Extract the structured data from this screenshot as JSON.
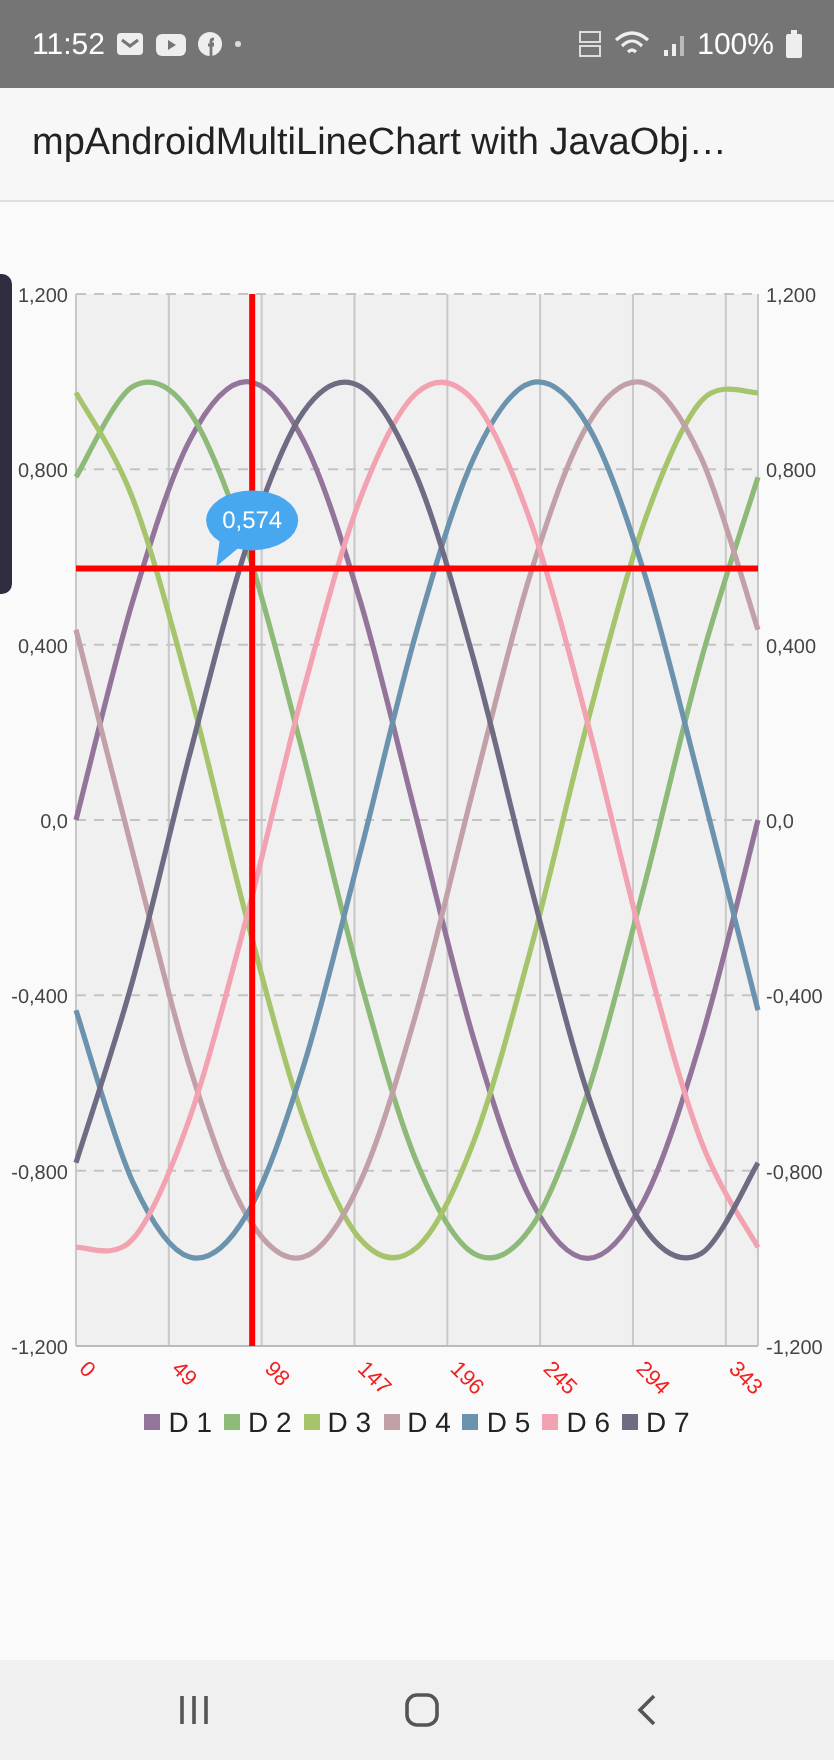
{
  "status_bar": {
    "time": "11:52",
    "battery": "100%"
  },
  "app_bar": {
    "title": "mpAndroidMultiLineChart with JavaObj…"
  },
  "chart": {
    "chart_data": {
      "type": "line",
      "x": [
        0,
        30,
        60,
        90,
        120,
        150,
        180,
        210,
        240,
        270,
        300,
        330,
        360
      ],
      "xlim": [
        0,
        360
      ],
      "ylim": [
        -1.2,
        1.2
      ],
      "xticks": [
        0,
        49,
        98,
        147,
        196,
        245,
        294,
        343
      ],
      "yticks": [
        {
          "value": -1.2,
          "label": "-1,200"
        },
        {
          "value": -0.8,
          "label": "-0,800"
        },
        {
          "value": -0.4,
          "label": "-0,400"
        },
        {
          "value": 0,
          "label": "0,0"
        },
        {
          "value": 0.4,
          "label": "0,400"
        },
        {
          "value": 0.8,
          "label": "0,800"
        },
        {
          "value": 1.2,
          "label": "1,200"
        }
      ],
      "series": [
        {
          "name": "D 1",
          "color": "#93749a",
          "values": [
            0,
            0.5,
            0.866,
            1,
            0.866,
            0.5,
            0,
            -0.5,
            -0.866,
            -1,
            -0.866,
            -0.5,
            0
          ]
        },
        {
          "name": "D 2",
          "color": "#8dba78",
          "values": [
            0.782,
            0.989,
            0.931,
            0.623,
            0.149,
            -0.365,
            -0.782,
            -0.989,
            -0.931,
            -0.623,
            -0.149,
            0.365,
            0.782
          ]
        },
        {
          "name": "D 3",
          "color": "#a6c46b",
          "values": [
            0.975,
            0.733,
            0.295,
            -0.223,
            -0.68,
            -0.956,
            -0.975,
            -0.733,
            -0.295,
            0.223,
            0.68,
            0.956,
            0.975
          ]
        },
        {
          "name": "D 4",
          "color": "#c2a0a8",
          "values": [
            0.434,
            -0.075,
            -0.563,
            -0.901,
            -0.997,
            -0.826,
            -0.434,
            0.075,
            0.563,
            0.901,
            0.997,
            0.826,
            0.434
          ]
        },
        {
          "name": "D 5",
          "color": "#6b93ad",
          "values": [
            -0.434,
            -0.826,
            -0.997,
            -0.901,
            -0.563,
            -0.075,
            0.434,
            0.826,
            0.997,
            0.901,
            0.563,
            0.075,
            -0.434
          ]
        },
        {
          "name": "D 6",
          "color": "#f2a2b0",
          "values": [
            -0.975,
            -0.956,
            -0.68,
            -0.223,
            0.295,
            0.733,
            0.975,
            0.956,
            0.68,
            0.223,
            -0.295,
            -0.733,
            -0.975
          ]
        },
        {
          "name": "D 7",
          "color": "#6f6b82",
          "values": [
            -0.782,
            -0.365,
            0.149,
            0.623,
            0.931,
            0.989,
            0.782,
            0.365,
            -0.149,
            -0.623,
            -0.931,
            -0.989,
            -0.782
          ]
        }
      ],
      "grid": true,
      "ref_lines": [
        {
          "axis": "x",
          "value": 93,
          "color": "#ff0000"
        },
        {
          "axis": "y",
          "value": 0.574,
          "color": "#ff0000",
          "label": "0,574"
        }
      ]
    },
    "right_yticks": [
      "1,200",
      "0,800",
      "0,400",
      "0,0",
      "-0,400",
      "-0,800",
      "-1,200"
    ]
  }
}
